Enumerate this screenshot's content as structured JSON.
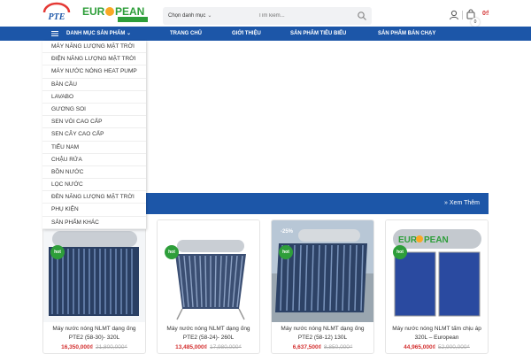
{
  "header": {
    "category_select": "Chọn danh mục",
    "search_placeholder": "Tìm kiếm...",
    "cart_count": "0",
    "cart_total": "0₫"
  },
  "nav": {
    "categories_label": "DANH MỤC SẢN PHẨM",
    "items": [
      "TRANG CHỦ",
      "GIỚI THIỆU",
      "SẢN PHẨM TIÊU BIỂU",
      "SẢN PHẨM BÁN CHẠY"
    ]
  },
  "categories": [
    "MÁY NĂNG LƯỢNG MẶT TRỜI",
    "ĐIỆN NĂNG LƯỢNG MẶT TRỜI",
    "MÁY NƯỚC NÓNG HEAT PUMP",
    "BÀN CẦU",
    "LAVABO",
    "GƯƠNG SOI",
    "SEN VÒI CAO CẤP",
    "SEN CÂY CAO CẤP",
    "TIỂU NAM",
    "CHẬU RỬA",
    "BỒN NƯỚC",
    "LỌC NƯỚC",
    "ĐÈN NĂNG LƯỢNG MẶT TRỜI",
    "PHỤ KIỆN",
    "SẢN PHẨM KHÁC"
  ],
  "section": {
    "see_more": "» Xem Thêm"
  },
  "products": [
    {
      "title": "Máy nước nóng NLMT dạng ống PTE2 (58-30)- 320L",
      "price": "16,350,000₫",
      "old_price": "21,800,000₫",
      "badge": "hot",
      "discount": ""
    },
    {
      "title": "Máy nước nóng NLMT dạng ống PTE2 (58-24)- 260L",
      "price": "13,485,000₫",
      "old_price": "17,980,000₫",
      "badge": "hot",
      "discount": ""
    },
    {
      "title": "Máy nước nóng NLMT dạng ống PTE2 (58-12) 130L",
      "price": "6,637,500₫",
      "old_price": "8,850,000₫",
      "badge": "hot",
      "discount": "-25%"
    },
    {
      "title": "Máy nước nóng NLMT tấm chịu áp 320L – European",
      "price": "44,965,000₫",
      "old_price": "52,900,000₫",
      "badge": "hot",
      "discount": ""
    }
  ],
  "colors": {
    "primary": "#1c56a8",
    "price": "#d32f2f",
    "hot_badge": "#2e9e3a"
  }
}
